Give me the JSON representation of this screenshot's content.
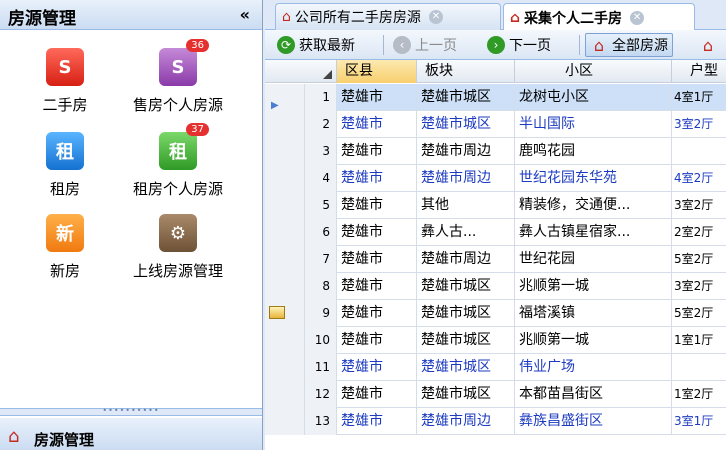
{
  "left_panel": {
    "title": "房源管理",
    "collapse_label": "«",
    "modules": [
      {
        "label": "二手房",
        "icon": "house-s-icon",
        "glyph": "S",
        "badge": ""
      },
      {
        "label": "售房个人房源",
        "icon": "house-s-personal-icon",
        "glyph": "S",
        "badge": "36"
      },
      {
        "label": "租房",
        "icon": "house-rent-icon",
        "glyph": "租",
        "badge": ""
      },
      {
        "label": "租房个人房源",
        "icon": "house-rent-personal-icon",
        "glyph": "租",
        "badge": "37"
      },
      {
        "label": "新房",
        "icon": "new-house-icon",
        "glyph": "新",
        "badge": ""
      },
      {
        "label": "上线房源管理",
        "icon": "online-listing-icon",
        "glyph": "⚙",
        "badge": ""
      }
    ],
    "footer_label": "房源管理"
  },
  "tabs": [
    {
      "label": "公司所有二手房房源",
      "close": "✕"
    },
    {
      "label": "采集个人二手房",
      "close": "✕"
    }
  ],
  "toolbar": {
    "refresh": "获取最新",
    "prev": "上一页",
    "next": "下一页",
    "all": "全部房源"
  },
  "grid": {
    "columns": [
      "区县",
      "板块",
      "小区",
      "户型"
    ],
    "rows": [
      {
        "n": "1",
        "c": [
          "楚雄市",
          "楚雄市城区",
          "龙树屯小区",
          "4室1厅"
        ],
        "blue": false
      },
      {
        "n": "2",
        "c": [
          "楚雄市",
          "楚雄市城区",
          "半山国际",
          "3室2厅"
        ],
        "blue": true
      },
      {
        "n": "3",
        "c": [
          "楚雄市",
          "楚雄市周边",
          "鹿鸣花园",
          ""
        ],
        "blue": false
      },
      {
        "n": "4",
        "c": [
          "楚雄市",
          "楚雄市周边",
          "世纪花园东华苑",
          "4室2厅"
        ],
        "blue": true
      },
      {
        "n": "5",
        "c": [
          "楚雄市",
          "其他",
          "精装修，交通便...",
          "3室2厅"
        ],
        "blue": false
      },
      {
        "n": "6",
        "c": [
          "楚雄市",
          "彝人古...",
          "彝人古镇星宿家...",
          "2室2厅"
        ],
        "blue": false
      },
      {
        "n": "7",
        "c": [
          "楚雄市",
          "楚雄市周边",
          "世纪花园",
          "5室2厅"
        ],
        "blue": false
      },
      {
        "n": "8",
        "c": [
          "楚雄市",
          "楚雄市城区",
          "兆顺第一城",
          "3室2厅"
        ],
        "blue": false
      },
      {
        "n": "9",
        "c": [
          "楚雄市",
          "楚雄市城区",
          "福塔溪镇",
          "5室2厅"
        ],
        "blue": false
      },
      {
        "n": "10",
        "c": [
          "楚雄市",
          "楚雄市城区",
          "兆顺第一城",
          "1室1厅"
        ],
        "blue": false
      },
      {
        "n": "11",
        "c": [
          "楚雄市",
          "楚雄市城区",
          "伟业广场",
          ""
        ],
        "blue": true
      },
      {
        "n": "12",
        "c": [
          "楚雄市",
          "楚雄市城区",
          "本都苗昌街区",
          "1室2厅"
        ],
        "blue": false
      },
      {
        "n": "13",
        "c": [
          "楚雄市",
          "楚雄市周边",
          "彝族昌盛街区",
          "3室1厅"
        ],
        "blue": true
      }
    ]
  }
}
